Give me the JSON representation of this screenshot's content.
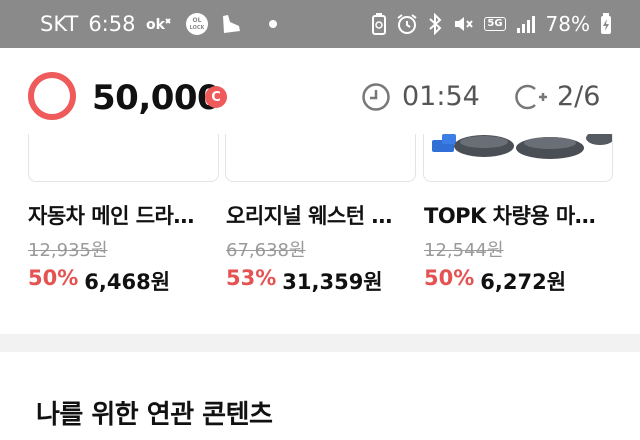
{
  "status_bar": {
    "carrier": "SKT",
    "time": "6:58",
    "app_icons": [
      "ok-cashbag-icon",
      "ol-lock-icon",
      "shoe-icon"
    ],
    "network": "5G",
    "battery": "78%"
  },
  "header": {
    "coin_amount": "50,000",
    "coin_unit": "C",
    "timer": "01:54",
    "round": "2/6",
    "accent_color": "#ef5a5a"
  },
  "products": [
    {
      "name": "자동차 메인 드라…",
      "original_price": "12,935원",
      "discount": "50%",
      "price": "6,468원"
    },
    {
      "name": "오리지널 웨스턴 …",
      "original_price": "67,638원",
      "discount": "53%",
      "price": "31,359원"
    },
    {
      "name": "TOPK 차량용 마…",
      "original_price": "12,544원",
      "discount": "50%",
      "price": "6,272원"
    }
  ],
  "section": {
    "title": "나를 위한 연관 콘텐츠"
  }
}
